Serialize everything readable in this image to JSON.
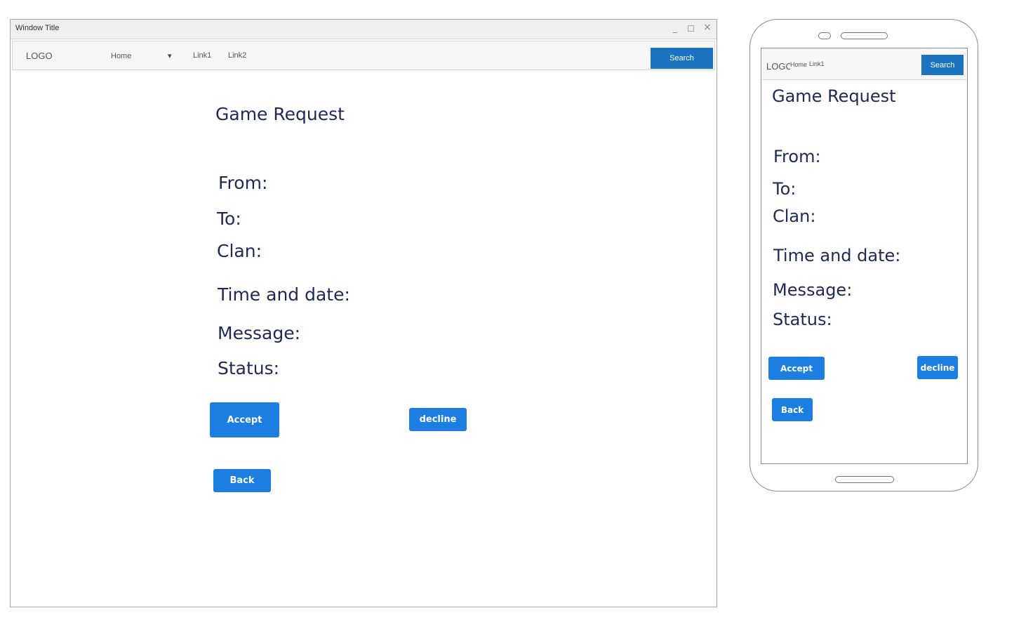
{
  "desktop": {
    "window_title": "Window Title",
    "controls": {
      "minimize": "_",
      "maximize": "☐",
      "close": "×"
    },
    "nav": {
      "logo": "LOGO",
      "home": "Home",
      "home_caret": "▾",
      "link1": "Link1",
      "link2": "Link2",
      "search_label": "Search"
    },
    "content": {
      "title": "Game Request",
      "labels": {
        "from": "From:",
        "to": "To:",
        "clan": "Clan:",
        "time_date": "Time and date:",
        "message": "Message:",
        "status": "Status:"
      },
      "buttons": {
        "accept": "Accept",
        "decline": "decline",
        "back": "Back"
      }
    }
  },
  "mobile": {
    "nav": {
      "logo": "LOGO",
      "home": "Home",
      "link1": "Link1",
      "search_label": "Search"
    },
    "content": {
      "title": "Game Request",
      "labels": {
        "from": "From:",
        "to": "To:",
        "clan": "Clan:",
        "time_date": "Time and date:",
        "message": "Message:",
        "status": "Status:"
      },
      "buttons": {
        "accept": "Accept",
        "decline": "decline",
        "back": "Back"
      }
    }
  },
  "colors": {
    "button_primary": "#1c7ee0",
    "nav_search": "#1c74c0",
    "text_dark": "#1e2a55"
  }
}
